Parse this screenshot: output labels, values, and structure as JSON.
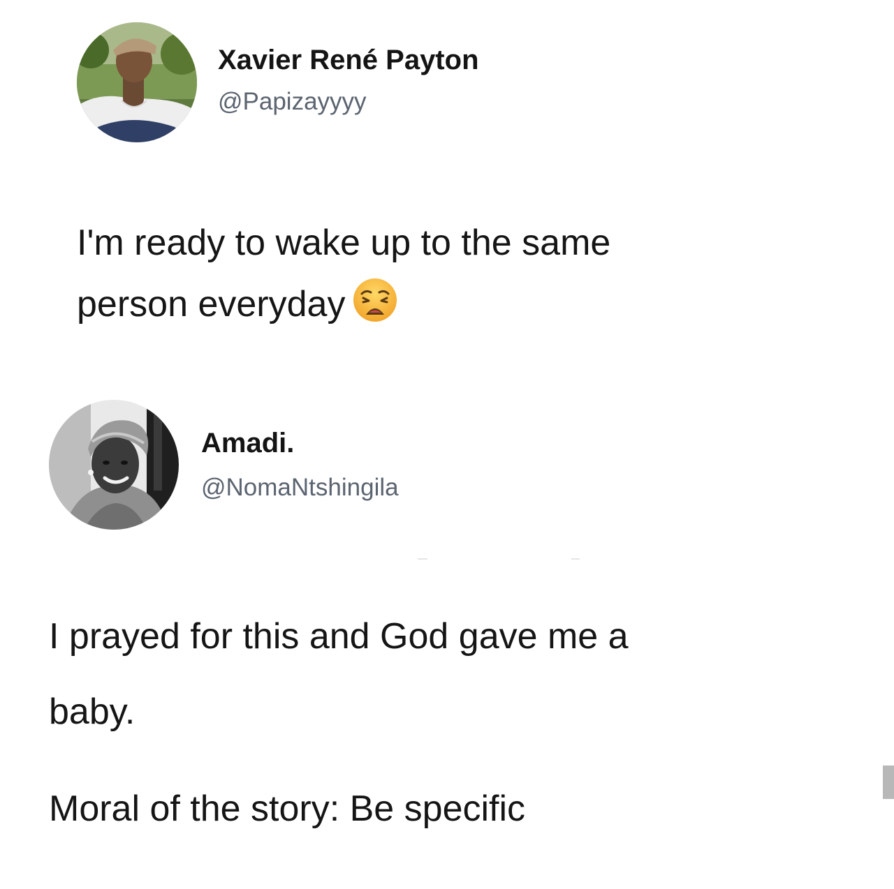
{
  "tweets": [
    {
      "author": {
        "name": "Xavier René Payton",
        "handle": "@Papizayyyy",
        "avatar_icon": "profile-photo-man-cap"
      },
      "text_lines": [
        "I'm ready to wake up to the same",
        "person everyday"
      ],
      "emoji": "weary-face-icon"
    },
    {
      "author": {
        "name": "Amadi.",
        "handle": "@NomaNtshingila",
        "avatar_icon": "profile-photo-woman-headwrap"
      },
      "text_lines": [
        "I prayed for this and God gave me a",
        "baby.",
        "Moral of the story: Be specific"
      ]
    }
  ],
  "colors": {
    "background": "#ffffff",
    "name_text": "#141414",
    "handle_text": "#5b6470",
    "body_text": "#151515",
    "emoji_face": "#f6b73c"
  }
}
